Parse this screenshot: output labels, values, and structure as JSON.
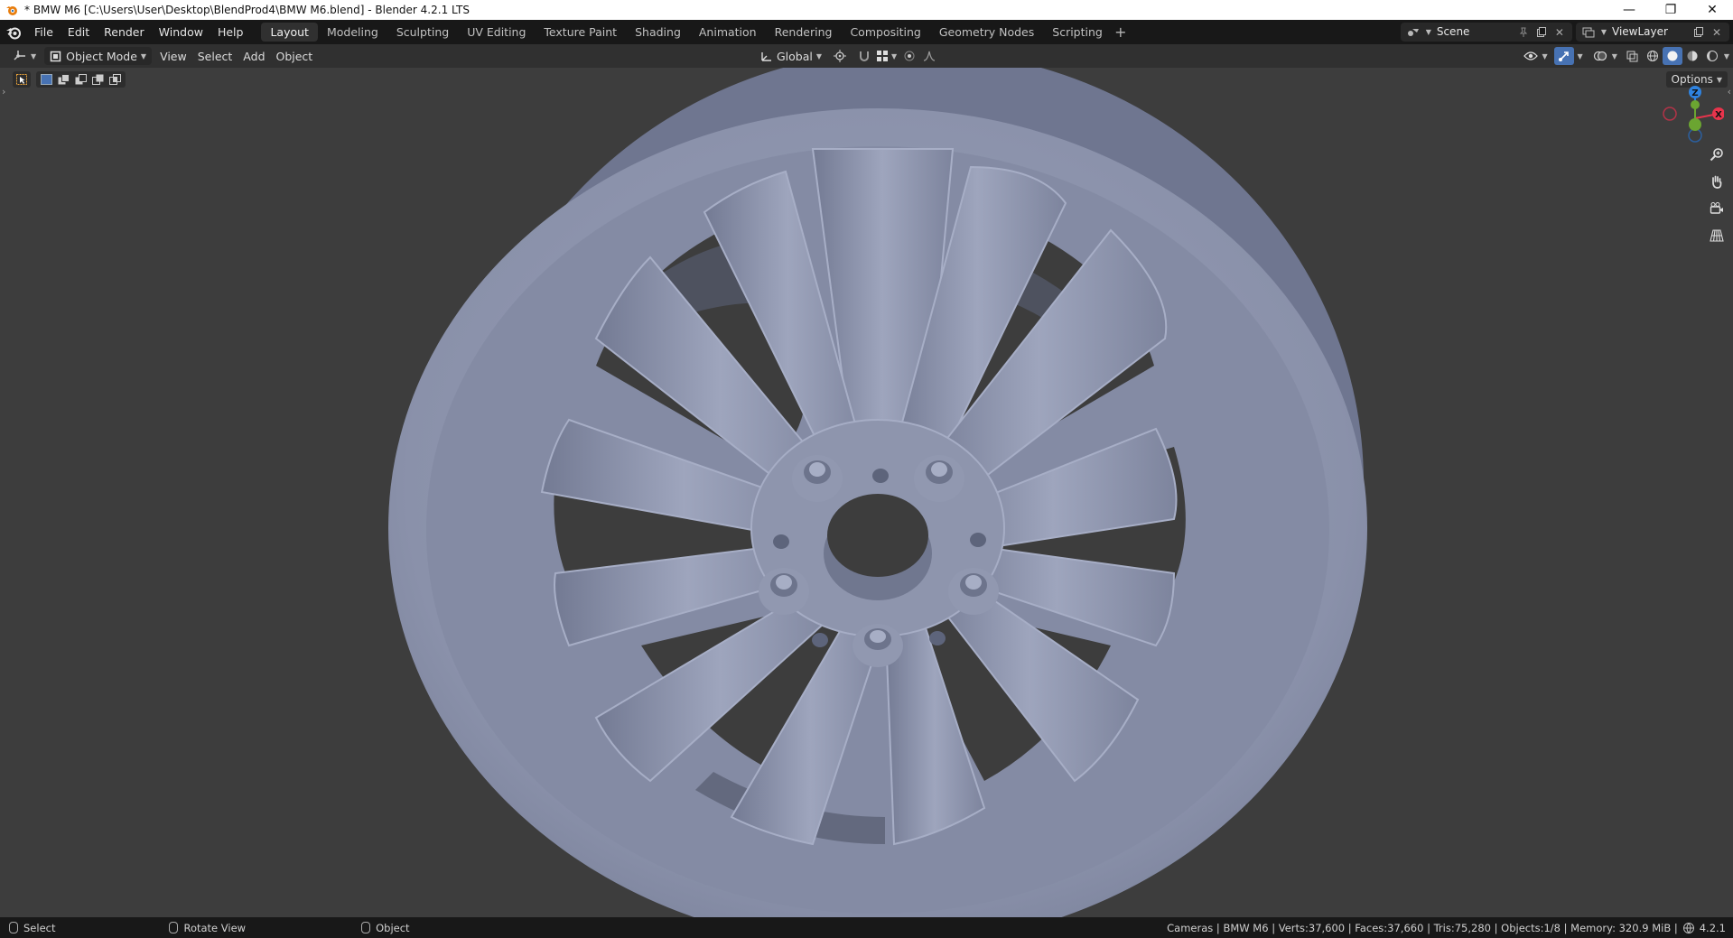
{
  "window": {
    "title": "* BMW M6 [C:\\Users\\User\\Desktop\\BlendProd4\\BMW M6.blend] - Blender 4.2.1 LTS",
    "controls": {
      "minimize": "—",
      "maximize": "❐",
      "close": "✕"
    }
  },
  "menu": {
    "items": [
      "File",
      "Edit",
      "Render",
      "Window",
      "Help"
    ]
  },
  "workspaces": {
    "tabs": [
      "Layout",
      "Modeling",
      "Sculpting",
      "UV Editing",
      "Texture Paint",
      "Shading",
      "Animation",
      "Rendering",
      "Compositing",
      "Geometry Nodes",
      "Scripting"
    ],
    "active": "Layout",
    "add": "+"
  },
  "scene": {
    "name": "Scene"
  },
  "viewlayer": {
    "name": "ViewLayer"
  },
  "viewport_header": {
    "mode": "Object Mode",
    "menus": [
      "View",
      "Select",
      "Add",
      "Object"
    ],
    "transform_orientation": "Global"
  },
  "viewport": {
    "options_label": "Options",
    "gizmo": {
      "z": "Z",
      "y": "Y",
      "x": "X"
    }
  },
  "statusbar": {
    "select": "Select",
    "rotate": "Rotate View",
    "object": "Object",
    "stats": "Cameras | BMW M6 | Verts:37,600 | Faces:37,660 | Tris:75,280 | Objects:1/8 | Memory: 320.9 MiB |",
    "version": "4.2.1"
  },
  "colors": {
    "accent": "#4772b3",
    "axis_x": "#e8344c",
    "axis_y": "#6ba531",
    "axis_z": "#2f83e0",
    "rim": "#8d94ad"
  }
}
